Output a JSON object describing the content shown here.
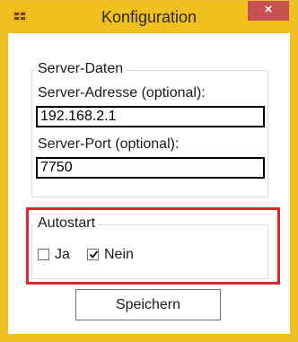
{
  "window": {
    "title": "Konfiguration",
    "close_glyph": "×",
    "icon": "app-icon"
  },
  "server_group": {
    "legend": "Server-Daten",
    "address_label": "Server-Adresse (optional):",
    "address_value": "192.168.2.1",
    "port_label": "Server-Port (optional):",
    "port_value": "7750"
  },
  "autostart_group": {
    "legend": "Autostart",
    "options": [
      {
        "label": "Ja",
        "checked": false
      },
      {
        "label": "Nein",
        "checked": true
      }
    ]
  },
  "actions": {
    "save_label": "Speichern"
  },
  "colors": {
    "titlebar": "#f0c020",
    "close_button": "#c75050",
    "highlight_border": "#e0242c"
  }
}
